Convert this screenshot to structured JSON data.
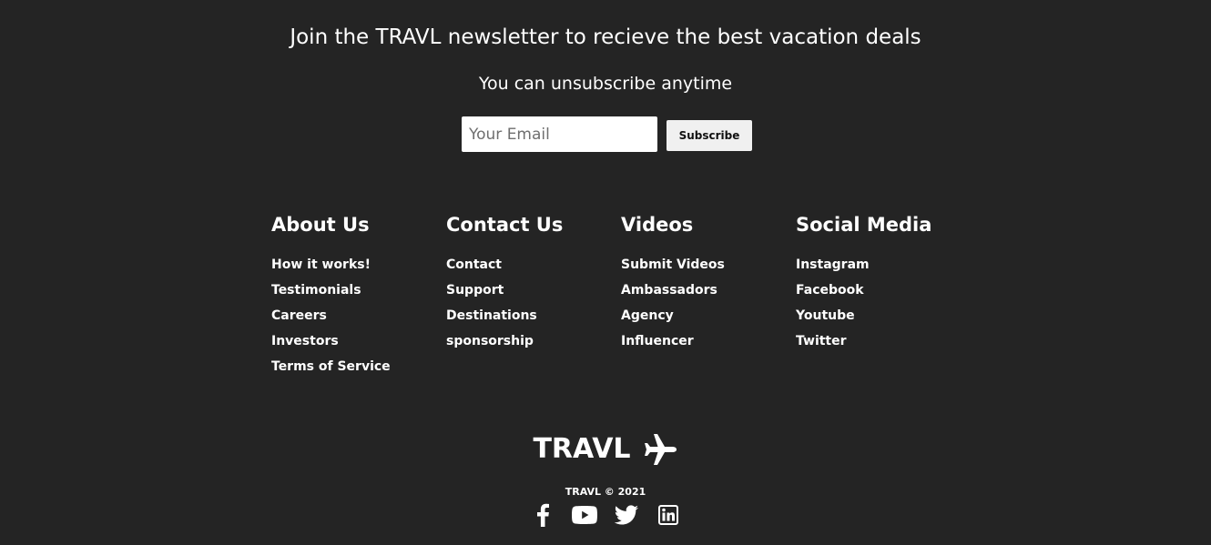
{
  "newsletter": {
    "heading": "Join the TRAVL newsletter to recieve the best vacation deals",
    "subheading": "You can unsubscribe anytime",
    "email_placeholder": "Your Email",
    "email_value": "",
    "subscribe_label": "Subscribe"
  },
  "columns": [
    {
      "title": "About Us",
      "links": [
        "How it works!",
        "Testimonials",
        "Careers",
        "Investors",
        "Terms of Service"
      ]
    },
    {
      "title": "Contact Us",
      "links": [
        "Contact",
        "Support",
        "Destinations",
        "sponsorship"
      ]
    },
    {
      "title": "Videos",
      "links": [
        "Submit Videos",
        "Ambassadors",
        "Agency",
        "Influencer"
      ]
    },
    {
      "title": "Social Media",
      "links": [
        "Instagram",
        "Facebook",
        "Youtube",
        "Twitter"
      ]
    }
  ],
  "brand": {
    "name": "TRAVL",
    "icon": "airplane-icon",
    "copyright": "TRAVL © 2021"
  },
  "social_icons": [
    "facebook-icon",
    "youtube-icon",
    "twitter-icon",
    "linkedin-icon"
  ],
  "colors": {
    "background": "#242424",
    "text": "#ffffff",
    "button_bg": "#f0f0f0"
  }
}
